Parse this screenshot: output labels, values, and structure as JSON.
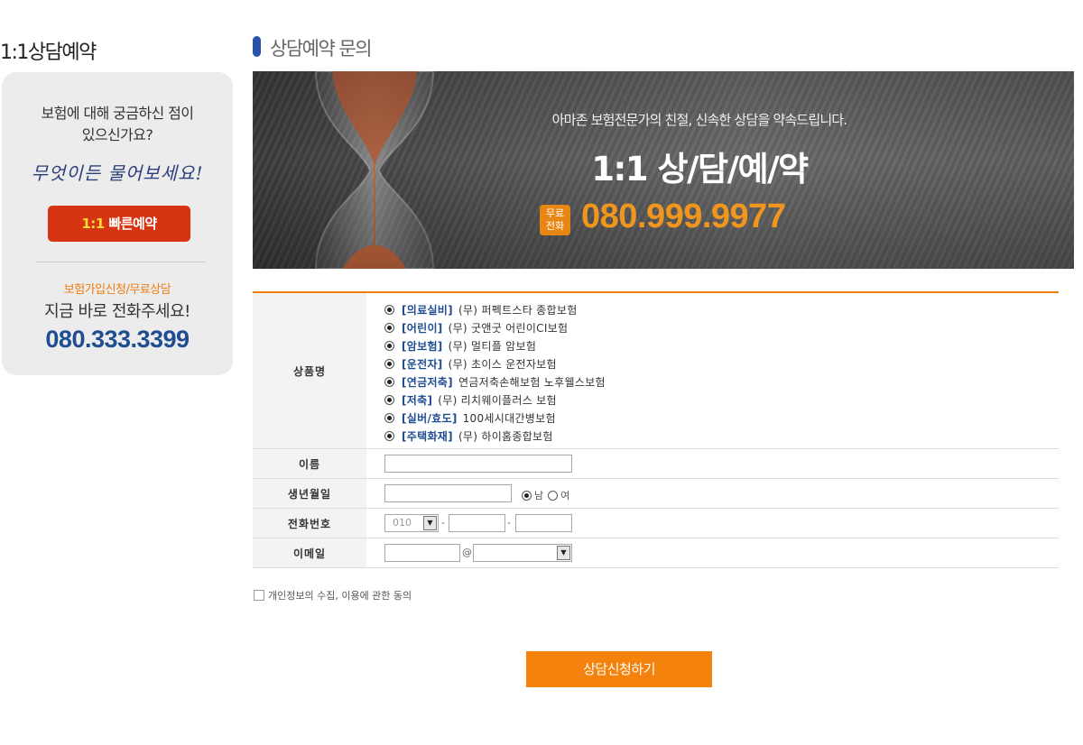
{
  "sidebar": {
    "title": "1:1상담예약",
    "question_line1": "보험에 대해 궁금하신 점이",
    "question_line2": "있으신가요?",
    "handwriting": "무엇이든 물어보세요!",
    "quick_button_prefix": "1:1",
    "quick_button_label": "빠른예약",
    "sub_label": "보험가입신청/무료상담",
    "call_text": "지금 바로 전화주세요!",
    "phone": "080.333.3399"
  },
  "header": {
    "title": "상담예약 문의"
  },
  "banner": {
    "subtitle": "아마존 보험전문가의 친절, 신속한 상담을 약속드립니다.",
    "title": "1:1 상/담/예/약",
    "free_line1": "무료",
    "free_line2": "전화",
    "phone": "080.999.9977"
  },
  "form": {
    "product_label": "상품명",
    "products": [
      {
        "category": "[의료실비]",
        "name": "(무) 퍼펙트스타 종합보험",
        "selected": true
      },
      {
        "category": "[어린이]",
        "name": "(무) 굿앤굿 어린이CI보험",
        "selected": true
      },
      {
        "category": "[암보험]",
        "name": "(무) 멀티플 암보험",
        "selected": true
      },
      {
        "category": "[운전자]",
        "name": "(무) 초이스 운전자보험",
        "selected": true
      },
      {
        "category": "[연금저축]",
        "name": "연금저축손해보험 노후웰스보험",
        "selected": true
      },
      {
        "category": "[저축]",
        "name": "(무) 리치웨이플러스 보험",
        "selected": true
      },
      {
        "category": "[실버/효도]",
        "name": "100세시대간병보험",
        "selected": true
      },
      {
        "category": "[주택화재]",
        "name": "(무) 하이홈종합보험",
        "selected": true
      }
    ],
    "name_label": "이름",
    "birth_label": "생년월일",
    "gender_male": "남",
    "gender_female": "여",
    "phone_label": "전화번호",
    "phone_prefix": "010",
    "email_label": "이메일",
    "email_at": "@",
    "agree_label": "개인정보의 수집, 이용에 관한 동의",
    "submit_label": "상담신청하기"
  }
}
